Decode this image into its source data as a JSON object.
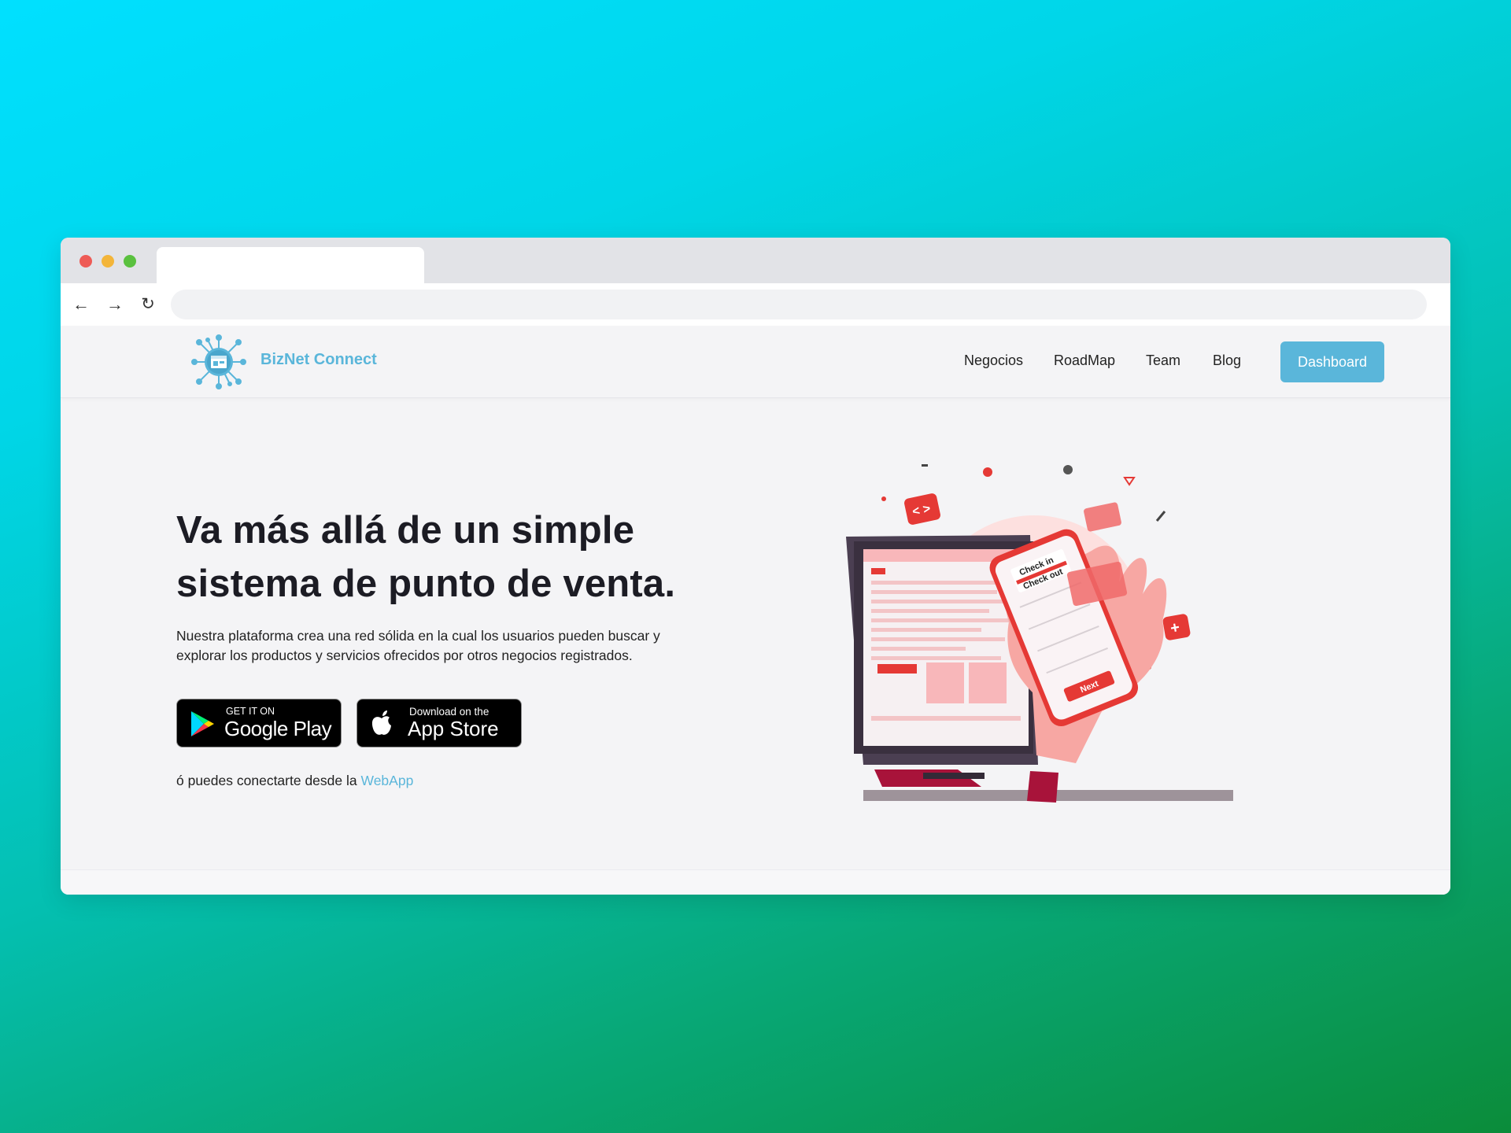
{
  "browser": {
    "url": "",
    "tab_title": ""
  },
  "brand": {
    "name": "BizNet Connect",
    "accent_color": "#5ab6da"
  },
  "nav": {
    "items": [
      {
        "label": "Negocios"
      },
      {
        "label": "RoadMap"
      },
      {
        "label": "Team"
      },
      {
        "label": "Blog"
      }
    ],
    "cta_label": "Dashboard"
  },
  "hero": {
    "title_line1": "Va más allá de un simple",
    "title_line2": "sistema de punto de venta.",
    "desc_line1": "Nuestra plataforma crea una red sólida en la cual los usuarios pueden buscar y",
    "desc_line2": "explorar los productos y servicios ofrecidos por otros negocios registrados.",
    "google_play": {
      "small": "GET IT ON",
      "big": "Google Play"
    },
    "app_store": {
      "small": "Download on the",
      "big": "App Store"
    },
    "webapp_prefix": "ó puedes conectarte desde la",
    "webapp_link": "WebApp"
  },
  "illustration": {
    "phone_check_in": "Check in",
    "phone_check_out": "Check out",
    "phone_next": "Next"
  }
}
